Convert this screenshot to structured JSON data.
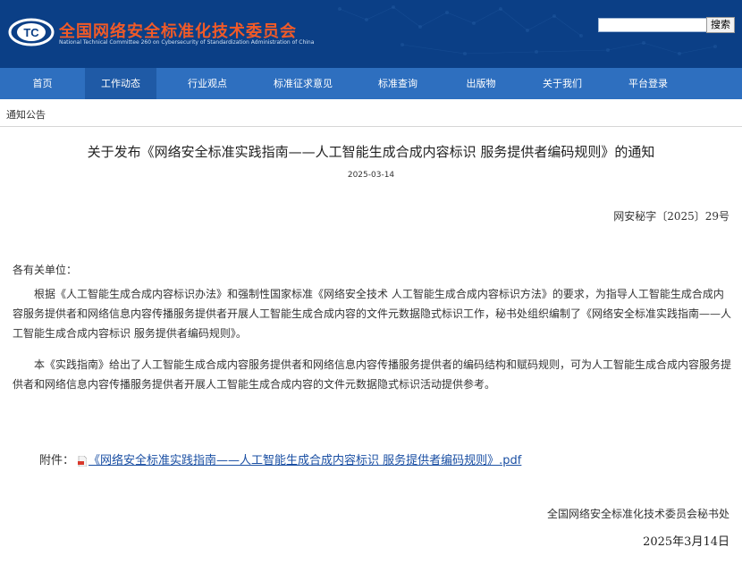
{
  "header": {
    "org_name_cn": "全国网络安全标准化技术委员会",
    "org_name_en": "National Technical Committee 260 on Cybersecurity of Standardization Administration of China",
    "logo_text": "TC",
    "search_placeholder": "",
    "search_button": "搜索"
  },
  "nav": {
    "items": [
      {
        "label": "首页"
      },
      {
        "label": "工作动态",
        "active": true
      },
      {
        "label": "行业观点"
      },
      {
        "label": "标准征求意见"
      },
      {
        "label": "标准查询"
      },
      {
        "label": "出版物"
      },
      {
        "label": "关于我们"
      },
      {
        "label": "平台登录"
      }
    ]
  },
  "breadcrumb": "通知公告",
  "article": {
    "title": "关于发布《网络安全标准实践指南——人工智能生成合成内容标识 服务提供者编码规则》的通知",
    "date": "2025-03-14",
    "doc_number": "网安秘字〔2025〕29号",
    "salutation": "各有关单位：",
    "paragraphs": [
      "根据《人工智能生成合成内容标识办法》和强制性国家标准《网络安全技术 人工智能生成合成内容标识方法》的要求，为指导人工智能生成合成内容服务提供者和网络信息内容传播服务提供者开展人工智能生成合成内容的文件元数据隐式标识工作，秘书处组织编制了《网络安全标准实践指南——人工智能生成合成内容标识 服务提供者编码规则》。",
      "本《实践指南》给出了人工智能生成合成内容服务提供者和网络信息内容传播服务提供者的编码结构和赋码规则，可为人工智能生成合成内容服务提供者和网络信息内容传播服务提供者开展人工智能生成合成内容的文件元数据隐式标识活动提供参考。"
    ],
    "attachment_label": "附件：",
    "attachment_link": "《网络安全标准实践指南——人工智能生成合成内容标识 服务提供者编码规则》.pdf",
    "signature_org": "全国网络安全标准化技术委员会秘书处",
    "signature_date": "2025年3月14日"
  },
  "colors": {
    "header_bg": "#0b3f86",
    "nav_bg": "#2e6fbf",
    "nav_active_bg": "#1f5aa6",
    "brand_orange": "#f05a28",
    "link": "#1a4fa3"
  }
}
